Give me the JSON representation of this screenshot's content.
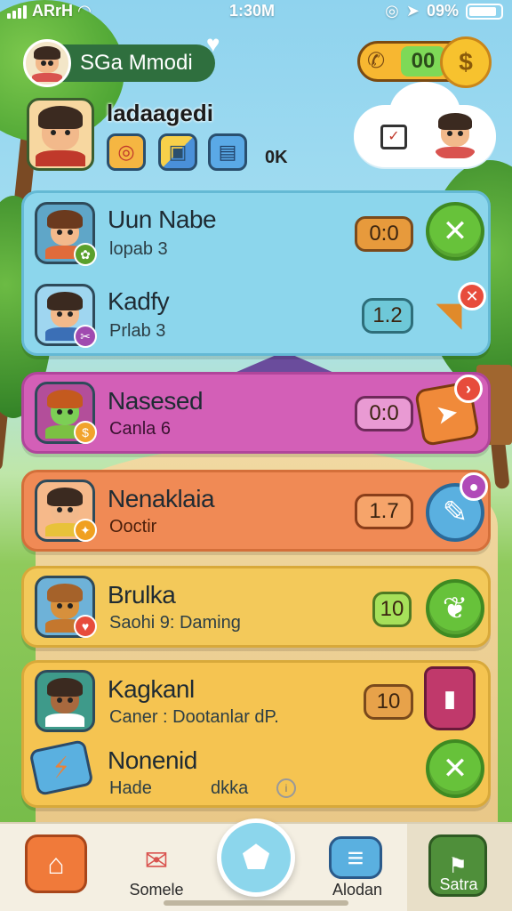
{
  "status_bar": {
    "carrier": "ARrH",
    "time": "1:30M",
    "battery": "09%"
  },
  "header": {
    "user_name": "SGa Mmodi",
    "coins": "00",
    "coin_symbol": "$",
    "player_name": "ladaagedi",
    "hud_text": "0K"
  },
  "cards": [
    {
      "name": "Uun Nabe",
      "subtitle": "lopab 3",
      "score": "0:0",
      "action": "close"
    },
    {
      "name": "Kadfy",
      "subtitle": "Prlab 3",
      "score": "1.2",
      "action": "hammer"
    },
    {
      "name": "Nasesed",
      "subtitle": "Canla 6",
      "score": "0:0",
      "action": "send"
    },
    {
      "name": "Nenaklaia",
      "subtitle": "Ooctir",
      "score": "1.7",
      "action": "pin"
    },
    {
      "name": "Brulka",
      "subtitle": "Saohi 9: Daming",
      "score": "10",
      "action": "leaf"
    },
    {
      "name": "Kagkanl",
      "subtitle": "Caner : Dootanlar dP.",
      "score": "10",
      "action": "bucket"
    },
    {
      "name": "Nonenid",
      "subtitle": "Hade",
      "subtitle_extra": "dkka",
      "action": "close"
    }
  ],
  "bottom_nav": {
    "items": [
      {
        "label": ""
      },
      {
        "label": "Somele"
      },
      {
        "label": ""
      },
      {
        "label": "Alodan"
      },
      {
        "label": "Satra"
      }
    ]
  },
  "colors": {
    "sky": "#8fd3ee",
    "grass": "#6fb844",
    "card_blue": "#8cd6ec",
    "card_pink": "#d35fb7",
    "card_orange": "#f08a55",
    "card_yellow": "#f3c95a",
    "accent_green": "#67c23a"
  }
}
